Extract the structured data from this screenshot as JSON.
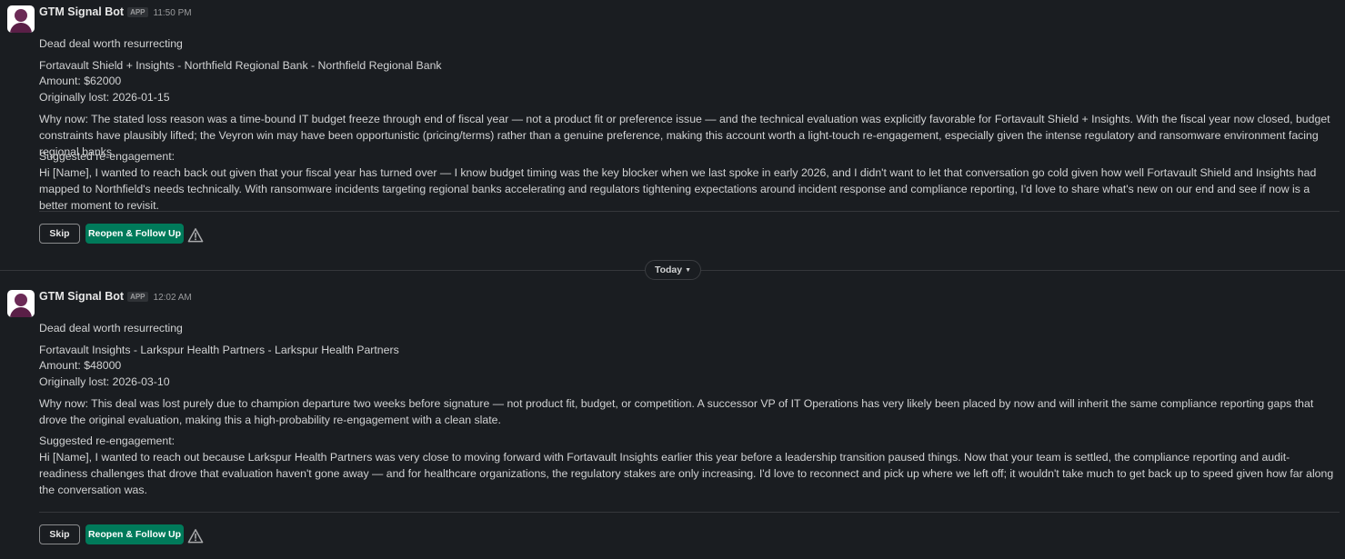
{
  "messages": [
    {
      "sender": "GTM Signal Bot",
      "badge": "APP",
      "time": "11:50 PM",
      "headline": "Dead deal worth resurrecting",
      "deal": "Fortavault Shield + Insights - Northfield Regional Bank - Northfield Regional Bank",
      "amount": "Amount: $62000",
      "lost": "Originally lost: 2026-01-15",
      "why_now": "Why now: The stated loss reason was a time-bound IT budget freeze through end of fiscal year — not a product fit or preference issue — and the technical evaluation was explicitly favorable for Fortavault Shield + Insights. With the fiscal year now closed, budget constraints have plausibly lifted; the Veyron win may have been opportunistic (pricing/terms) rather than a genuine preference, making this account worth a light-touch re-engagement, especially given the intense regulatory and ransomware environment facing regional banks.",
      "suggested_label": "Suggested re-engagement:",
      "suggested_text": "Hi [Name], I wanted to reach back out given that your fiscal year has turned over — I know budget timing was the key blocker when we last spoke in early 2026, and I didn't want to let that conversation go cold given how well Fortavault Shield and Insights had mapped to Northfield's needs technically. With ransomware incidents targeting regional banks accelerating and regulators tightening expectations around incident response and compliance reporting, I'd love to share what's new on our end and see if now is a better moment to revisit.",
      "skip_label": "Skip",
      "reopen_label": "Reopen & Follow Up"
    },
    {
      "sender": "GTM Signal Bot",
      "badge": "APP",
      "time": "12:02 AM",
      "headline": "Dead deal worth resurrecting",
      "deal": "Fortavault Insights - Larkspur Health Partners - Larkspur Health Partners",
      "amount": "Amount: $48000",
      "lost": "Originally lost: 2026-03-10",
      "why_now": "Why now: This deal was lost purely due to champion departure two weeks before signature — not product fit, budget, or competition. A successor VP of IT Operations has very likely been placed by now and will inherit the same compliance reporting gaps that drove the original evaluation, making this a high-probability re-engagement with a clean slate.",
      "suggested_label": "Suggested re-engagement:",
      "suggested_text": "Hi [Name], I wanted to reach out because Larkspur Health Partners was very close to moving forward with Fortavault Insights earlier this year before a leadership transition paused things. Now that your team is settled, the compliance reporting and audit-readiness challenges that drove that evaluation haven't gone away — and for healthcare organizations, the regulatory stakes are only increasing. I'd love to reconnect and pick up where we left off; it wouldn't take much to get back up to speed given how far along the conversation was.",
      "skip_label": "Skip",
      "reopen_label": "Reopen & Follow Up"
    }
  ],
  "divider": {
    "label": "Today"
  },
  "colors": {
    "background": "#1a1d21",
    "text": "#d1d2d3",
    "reopen_button": "#007a5a",
    "avatar_figure": "#5a1f47"
  },
  "icons": {
    "warning": "warning-triangle-icon",
    "divider_chevron": "chevron-down-icon"
  }
}
